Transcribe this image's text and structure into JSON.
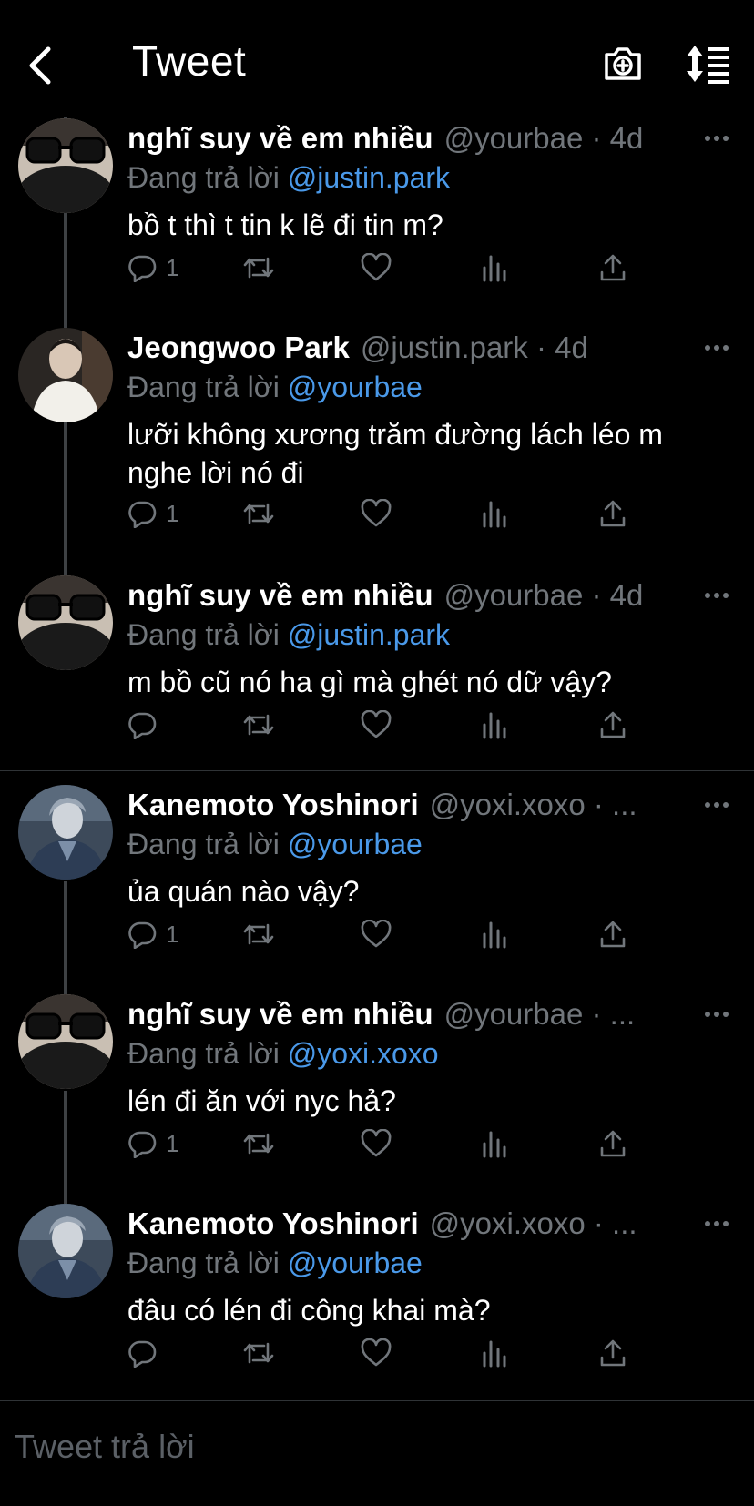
{
  "header": {
    "title": "Tweet",
    "back_icon": "chevron-left-icon",
    "camera_icon": "camera-plus-icon",
    "sort_icon": "sort-list-icon"
  },
  "tweets": [
    {
      "name": "nghĩ suy về em nhiều",
      "meta": "@yourbae · 4d",
      "reply_prefix": "Đang trả lời",
      "reply_to": "@justin.park",
      "text": "bồ t thì t tin k lẽ đi tin m?",
      "reply_count": "1"
    },
    {
      "name": "Jeongwoo Park",
      "meta": "@justin.park · 4d",
      "reply_prefix": "Đang trả lời",
      "reply_to": "@yourbae",
      "text": "lưỡi không xương trăm đường lách léo m nghe lời nó đi",
      "reply_count": "1"
    },
    {
      "name": "nghĩ suy về em nhiều",
      "meta": "@yourbae · 4d",
      "reply_prefix": "Đang trả lời",
      "reply_to": "@justin.park",
      "text": "m bồ cũ nó ha gì mà ghét nó dữ vậy?",
      "reply_count": ""
    },
    {
      "name": "Kanemoto Yoshinori",
      "meta": "@yoxi.xoxo · ...",
      "reply_prefix": "Đang trả lời",
      "reply_to": "@yourbae",
      "text": "ủa quán nào vậy?",
      "reply_count": "1"
    },
    {
      "name": "nghĩ suy về em nhiều",
      "meta": "@yourbae · ...",
      "reply_prefix": "Đang trả lời",
      "reply_to": "@yoxi.xoxo",
      "text": "lén đi ăn với nyc hả?",
      "reply_count": "1"
    },
    {
      "name": "Kanemoto Yoshinori",
      "meta": "@yoxi.xoxo · ...",
      "reply_prefix": "Đang trả lời",
      "reply_to": "@yourbae",
      "text": "đâu có lén đi công khai mà?",
      "reply_count": ""
    }
  ],
  "composer": {
    "placeholder": "Tweet trả lời"
  },
  "colors": {
    "background": "#000000",
    "text": "#ffffff",
    "muted": "#71767b",
    "link": "#4a99e9",
    "divider": "#2f3336"
  }
}
